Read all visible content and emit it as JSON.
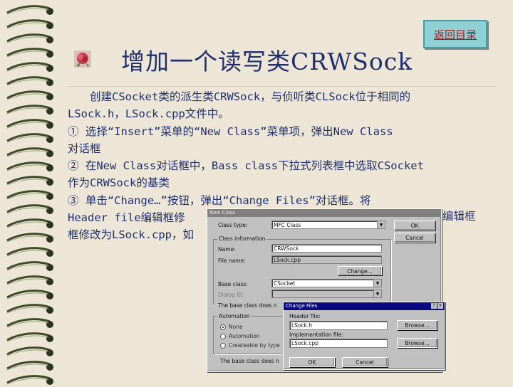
{
  "back_button_label": "返回目录",
  "title": "增加一个读写类CRWSock",
  "paragraph_lines": [
    "　　创建CSocket类的派生类CRWSock，与侦听类CLSock位于相同的",
    "LSock.h，LSock.cpp文件中。",
    "① 选择“Insert”菜单的“New Class”菜单项，弹出New Class",
    "对话框",
    "② 在New Class对话框中，Bass class下拉式列表框中选取CSocket",
    "作为CRWSock的基类",
    "③ 单击“Change…”按钮，弹出“Change Files”对话框。将",
    "Header file编辑框修",
    "框修改为LSock.cpp，如"
  ],
  "line7_tail": "编辑框",
  "new_class_dialog": {
    "title": "New Class",
    "class_type_label": "Class type:",
    "class_type_value": "MFC Class",
    "ok": "OK",
    "cancel": "Cancel",
    "class_info_label": "Class information",
    "name_label": "Name:",
    "name_value": "CRWSock",
    "file_name_label": "File name:",
    "file_name_value": "LSock.cpp",
    "change_button": "Change...",
    "base_class_label": "Base class:",
    "base_class_value": "CSocket",
    "dialog_id_label": "Dialog ID:",
    "base_class_note": "The base class does n",
    "automation_label": "Automation",
    "radio_none": "None",
    "radio_automation": "Automation",
    "radio_createable": "Createable by type",
    "bottom_note": "The base class does n"
  },
  "change_files_dialog": {
    "title": "Change Files",
    "header_label": "Header file:",
    "header_value": "LSock.h",
    "impl_label": "Implementation file:",
    "impl_value": "LSock.cpp",
    "browse": "Browse...",
    "ok": "OK",
    "cancel": "Cancel"
  }
}
